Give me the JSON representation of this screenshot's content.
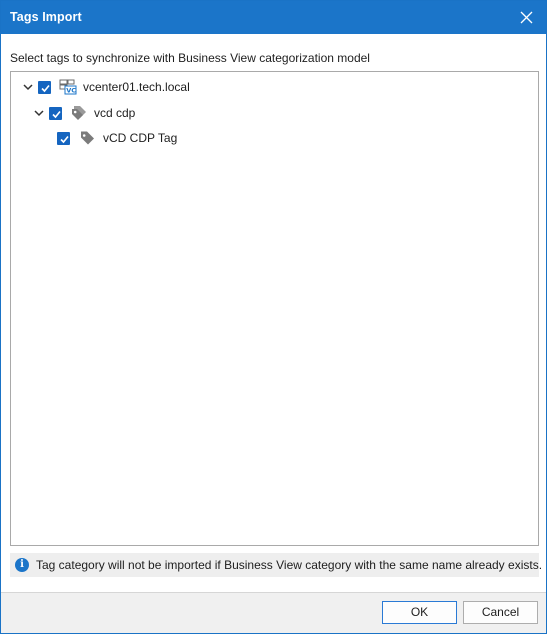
{
  "window": {
    "title": "Tags Import",
    "accent_color": "#1b75c9"
  },
  "instruction": "Select tags to synchronize with Business View categorization model",
  "tree": {
    "nodes": [
      {
        "label": "vcenter01.tech.local",
        "icon": "vcenter-server-icon",
        "checked": true,
        "expanded": true,
        "level": 0
      },
      {
        "label": "vcd cdp",
        "icon": "tag-category-icon",
        "checked": true,
        "expanded": true,
        "level": 1
      },
      {
        "label": "vCD CDP Tag",
        "icon": "tag-icon",
        "checked": true,
        "level": 2
      }
    ],
    "checkbox_color": "#1565c0"
  },
  "info": {
    "icon": "info-icon",
    "text": "Tag category will not be imported if Business View category with the same name already exists."
  },
  "buttons": {
    "ok_label": "OK",
    "cancel_label": "Cancel"
  }
}
